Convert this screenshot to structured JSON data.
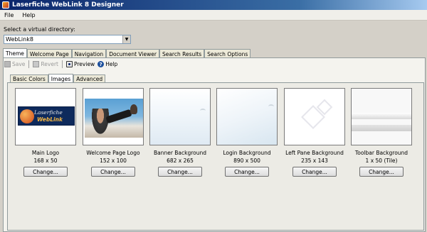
{
  "window": {
    "title": "Laserfiche WebLink 8 Designer"
  },
  "menu": {
    "items": [
      "File",
      "Help"
    ]
  },
  "directory": {
    "label": "Select a virtual directory:",
    "value": "WebLink8"
  },
  "tabs": [
    "Theme",
    "Welcome Page",
    "Navigation",
    "Document Viewer",
    "Search Results",
    "Search Options"
  ],
  "active_tab": "Theme",
  "toolbar": {
    "save": "Save",
    "revert": "Revert",
    "preview": "Preview",
    "help": "Help"
  },
  "subtabs": [
    "Basic Colors",
    "Images",
    "Advanced"
  ],
  "active_subtab": "Images",
  "logo_text": {
    "line1": "Laserfiche",
    "line2": "WebLink"
  },
  "images": [
    {
      "name": "Main Logo",
      "dims": "168 x 50",
      "button": "Change..."
    },
    {
      "name": "Welcome Page Logo",
      "dims": "152 x 100",
      "button": "Change..."
    },
    {
      "name": "Banner Background",
      "dims": "682 x 265",
      "button": "Change..."
    },
    {
      "name": "Login Background",
      "dims": "890 x 500",
      "button": "Change..."
    },
    {
      "name": "Left Pane Background",
      "dims": "235 x 143",
      "button": "Change..."
    },
    {
      "name": "Toolbar Background",
      "dims": "1 x 50 (Tile)",
      "button": "Change..."
    }
  ]
}
